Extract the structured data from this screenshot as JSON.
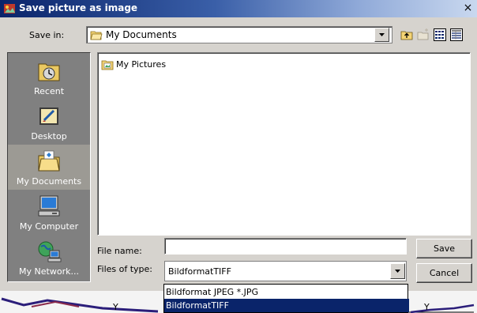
{
  "window": {
    "title": "Save picture as image",
    "close_glyph": "×"
  },
  "save_in": {
    "label": "Save in:",
    "value": "My Documents"
  },
  "toolbar": {
    "icons": [
      "up-folder-icon",
      "new-folder-icon",
      "list-view-icon",
      "details-view-icon"
    ]
  },
  "places": [
    {
      "label": "Recent",
      "icon": "recent-icon",
      "selected": false
    },
    {
      "label": "Desktop",
      "icon": "desktop-icon",
      "selected": false
    },
    {
      "label": "My Documents",
      "icon": "my-documents-icon",
      "selected": true
    },
    {
      "label": "My Computer",
      "icon": "my-computer-icon",
      "selected": false
    },
    {
      "label": "My Network...",
      "icon": "my-network-icon",
      "selected": false
    }
  ],
  "files": [
    {
      "name": "My Pictures",
      "icon": "folder-icon"
    }
  ],
  "file_name": {
    "label": "File name:",
    "value": ""
  },
  "file_type": {
    "label": "Files of type:",
    "value": "BildformatTIFF",
    "options": [
      "Bildformat JPEG *.JPG",
      "BildformatTIFF"
    ],
    "selected_index": 1
  },
  "buttons": {
    "save": "Save",
    "cancel": "Cancel"
  },
  "background": {
    "marks": [
      "Y",
      "Y"
    ]
  },
  "colors": {
    "title_bar": "#0a246a",
    "face": "#d6d3ce",
    "places_bg": "#808080",
    "selection": "#0a246a"
  }
}
